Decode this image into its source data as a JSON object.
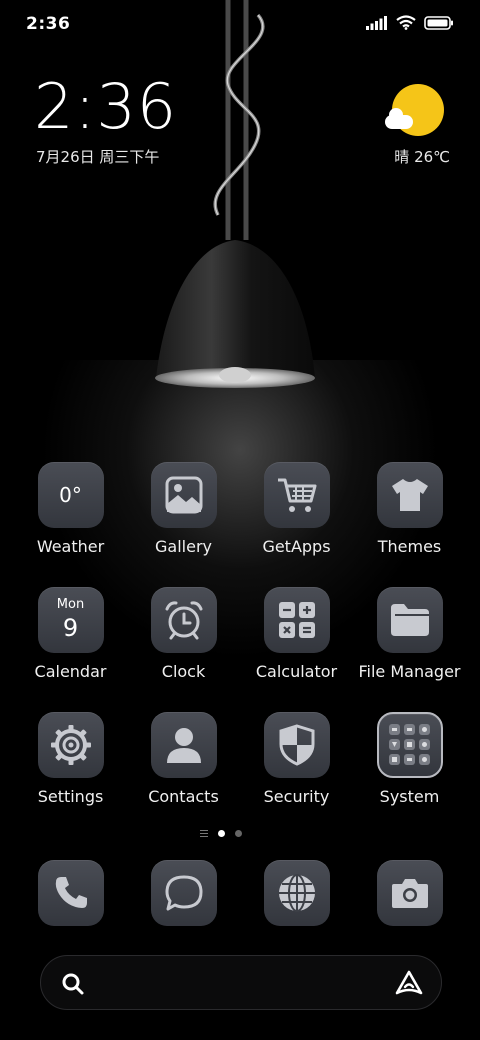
{
  "status_bar": {
    "time": "2:36",
    "icons": [
      "signal-icon",
      "wifi-icon",
      "battery-icon"
    ]
  },
  "clock_widget": {
    "time": "2:36",
    "date": "7月26日 周三下午"
  },
  "weather_widget": {
    "text": "晴 26℃",
    "icon": "sun-cloud-icon"
  },
  "apps": [
    {
      "label": "Weather",
      "icon": "weather-icon",
      "glyph": "0°"
    },
    {
      "label": "Gallery",
      "icon": "gallery-icon"
    },
    {
      "label": "GetApps",
      "icon": "cart-icon"
    },
    {
      "label": "Themes",
      "icon": "tshirt-icon"
    },
    {
      "label": "Calendar",
      "icon": "calendar-icon",
      "day_name": "Mon",
      "day_num": "9"
    },
    {
      "label": "Clock",
      "icon": "alarm-clock-icon"
    },
    {
      "label": "Calculator",
      "icon": "calculator-icon"
    },
    {
      "label": "File Manager",
      "icon": "folder-icon"
    },
    {
      "label": "Settings",
      "icon": "gear-icon"
    },
    {
      "label": "Contacts",
      "icon": "person-icon"
    },
    {
      "label": "Security",
      "icon": "shield-icon"
    },
    {
      "label": "System",
      "icon": "folder-grid-icon"
    }
  ],
  "page_indicator": {
    "pages": 2,
    "current": 1
  },
  "dock": [
    "phone-icon",
    "message-icon",
    "globe-icon",
    "camera-icon"
  ],
  "search_bar": {
    "left_icon": "search-icon",
    "right_icon": "assistant-icon"
  },
  "colors": {
    "background": "#000000",
    "icon_tile": "#3d4047",
    "sun": "#f5c518"
  }
}
